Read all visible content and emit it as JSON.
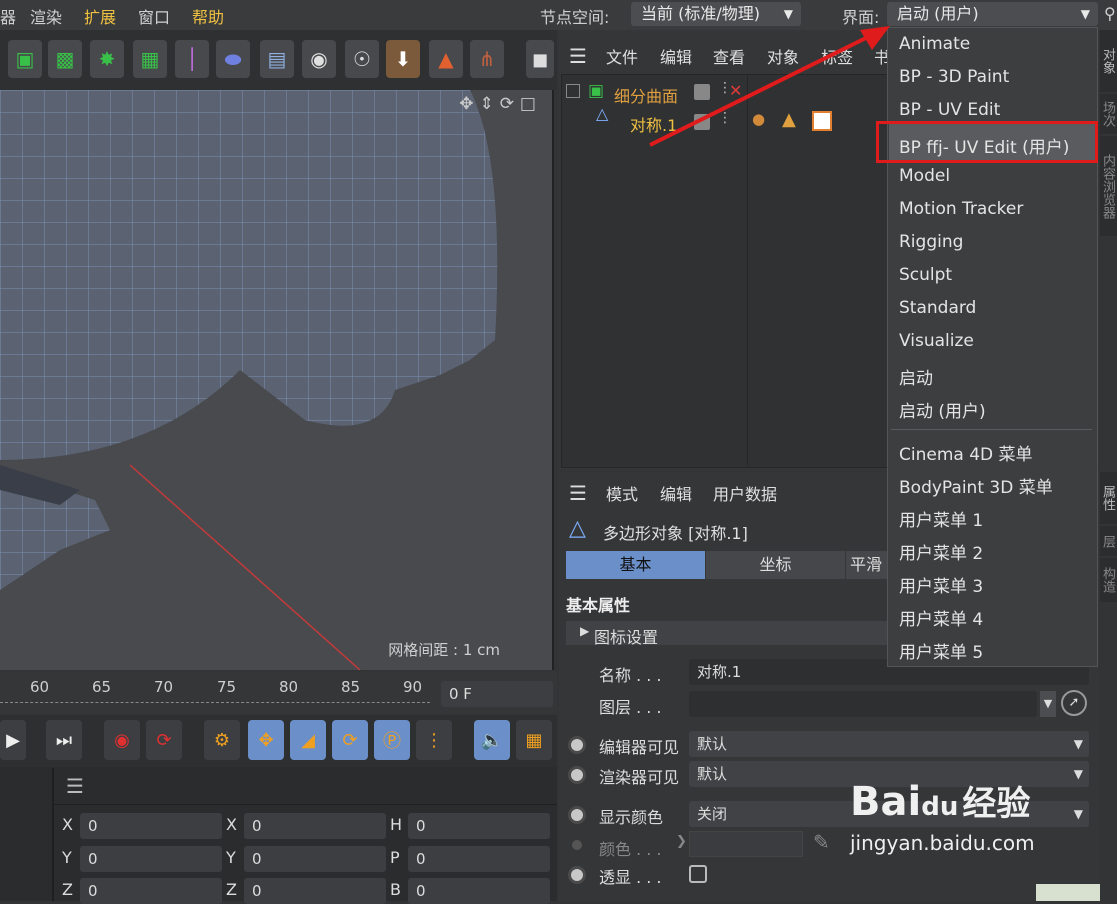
{
  "menubar": {
    "items": [
      "器",
      "渲染",
      "扩展",
      "窗口",
      "帮助"
    ],
    "node_space_label": "节点空间:",
    "node_space_value": "当前 (标准/物理)",
    "layout_label": "界面:",
    "layout_value": "启动 (用户)"
  },
  "object_manager": {
    "menu": [
      "文件",
      "编辑",
      "查看",
      "对象",
      "标签",
      "书"
    ],
    "objects": [
      {
        "name": "细分曲面",
        "color": "#e0a040"
      },
      {
        "name": "对称.1",
        "color": "#f0c040"
      }
    ]
  },
  "viewport": {
    "grid_spacing": "网格间距 : 1 cm"
  },
  "timeline": {
    "ticks": [
      "60",
      "65",
      "70",
      "75",
      "80",
      "85",
      "90"
    ],
    "frame": "0 F"
  },
  "coordinates": {
    "rows": [
      [
        {
          "label": "X",
          "value": "0"
        },
        {
          "label": "X",
          "value": "0"
        },
        {
          "label": "H",
          "value": "0"
        }
      ],
      [
        {
          "label": "Y",
          "value": "0"
        },
        {
          "label": "Y",
          "value": "0"
        },
        {
          "label": "P",
          "value": "0"
        }
      ],
      [
        {
          "label": "Z",
          "value": "0"
        },
        {
          "label": "Z",
          "value": "0"
        },
        {
          "label": "B",
          "value": "0"
        }
      ]
    ]
  },
  "attributes": {
    "menu": [
      "模式",
      "编辑",
      "用户数据"
    ],
    "object_title": "多边形对象 [对称.1]",
    "tabs": [
      "基本",
      "坐标",
      "平滑"
    ],
    "section": "基本属性",
    "subsection": "图标设置",
    "fields": {
      "name_label": "名称 . . .",
      "name_value": "对称.1",
      "layer_label": "图层 . . .",
      "layer_value": "",
      "editor_visible_label": "编辑器可见",
      "editor_visible_value": "默认",
      "render_visible_label": "渲染器可见",
      "render_visible_value": "默认",
      "display_color_label": "显示颜色",
      "display_color_value": "关闭",
      "color_label": "颜色 . . .",
      "xray_label": "透显 . . ."
    }
  },
  "layout_dropdown": {
    "items": [
      "Animate",
      "BP - 3D Paint",
      "BP - UV Edit",
      "BP ffj- UV Edit (用户)",
      "Model",
      "Motion Tracker",
      "Rigging",
      "Sculpt",
      "Standard",
      "Visualize",
      "启动",
      "启动 (用户)"
    ],
    "items2": [
      "Cinema 4D 菜单",
      "BodyPaint 3D 菜单",
      "用户菜单 1",
      "用户菜单 2",
      "用户菜单 3",
      "用户菜单 4",
      "用户菜单 5"
    ],
    "selected_index": 3
  },
  "side_tabs": [
    "对象",
    "场次",
    "内容浏览器",
    "属性",
    "层",
    "构造"
  ],
  "watermark": {
    "brand": "Bai",
    "paw": "du",
    "cn": "经验",
    "url": "jingyan.baidu.com"
  },
  "colors": {
    "accent": "#f0c040",
    "highlight": "#e01b1b",
    "tab_active": "#6b8fc9"
  }
}
